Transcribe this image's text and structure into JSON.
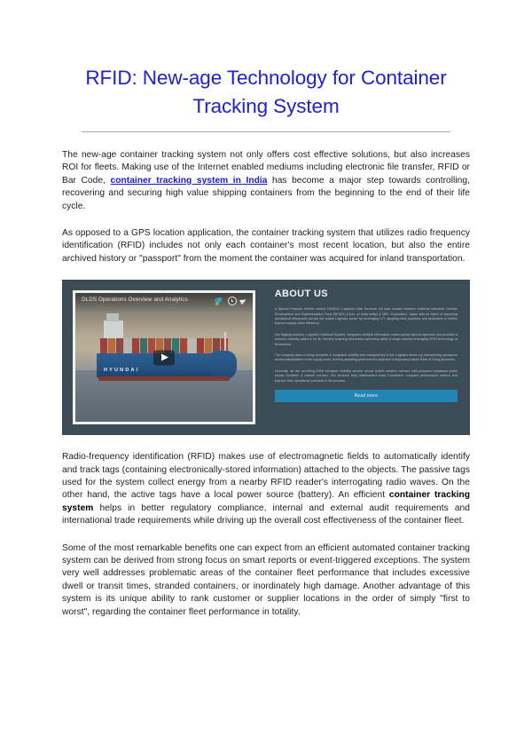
{
  "document": {
    "title": "RFID: New-age Technology for Container Tracking System",
    "title_line1": "RFID: New-age Technology for Container",
    "title_line2": "Tracking System",
    "title_color": "#2020cc"
  },
  "paragraphs": {
    "p1_part1": "The new-age container tracking system not only offers cost effective solutions, but also increases ROI for fleets. Making use of the Internet enabled mediums including electronic file transfer, RFID or Bar Code, ",
    "p1_link": "container tracking system in India",
    "p1_part2": " has become a major step towards controlling, recovering and securing high value shipping containers from the beginning to the end of their life cycle.",
    "p2": "As opposed to a GPS location application, the container tracking system that utilizes radio frequency identification (RFID) includes not only each container's most recent location, but also the entire archived history or \"passport\" from the moment the container was acquired for inland transportation.",
    "p3_part1": "Radio-frequency identification (RFID) makes use of electromagnetic fields to automatically identify and track tags (containing electronically-stored information) attached to the objects. The passive tags used for the system collect energy from a nearby RFID reader's interrogating radio waves. On the other hand, the active tags have a local power source (battery). An efficient ",
    "p3_bold": "container tracking system",
    "p3_part2": " helps in better regulatory compliance, internal and external audit requirements and international trade requirements while driving up the overall cost effectiveness of the container fleet.",
    "p4": "Some of the most remarkable benefits one can expect from an efficient automated container tracking system can be derived from strong focus on smart reports or event-triggered exceptions. The system very well addresses problematic areas of the container fleet performance that includes excessive dwell or transit times, stranded containers, or inordinately high damage. Another advantage of this system is its unique ability to rank customer or supplier locations in the order of simply \"first to worst\", regarding the container fleet performance in totality."
  },
  "figure": {
    "background_color": "#3c4c56",
    "video": {
      "title": "DLDS Operations Overview and Analytics",
      "ship_name": "HYUNDAI",
      "play_label": "Play",
      "icons": [
        "channel-logo-icon",
        "watch-later-icon",
        "share-icon"
      ]
    },
    "about": {
      "heading": "ABOUT US",
      "paragraphs": [
        "A Special Purpose Vehicle named DMICDC Logistics Data Services Ltd was created between National Industrial Corridor Development and Implementation Trust (NICDIT) (Govt. of India entity) & NEC Corporation, Japan with an intent of improving operational efficiencies across the Indian Logistics sector by leveraging ICT, adopting best practices and processes to further improve supply chain efficiency.",
        "Our flagship solution, Logistics Databank System, integrates multiple information nodes across various agencies and provides a common visibility platform for all, thereby ensuring information symmetry within a single window leveraging RFID technology at its backend.",
        "The company aims to bring complete & integrated visibility and transparency in the Logistics sector, by streamlining operations across stakeholders in the supply chain, thereby assisting government's objective of improving India's Ease of Doing Business.",
        "Currently, we are providing EXIM container visibility service across India's western corridor, with proposed expansion plans across Southern & eastern corridor. Our services help stakeholders track Containers, compare performance metrics and improve their operational practices in the process."
      ],
      "read_more_label": "Read more",
      "read_more_color": "#2285b4"
    }
  }
}
